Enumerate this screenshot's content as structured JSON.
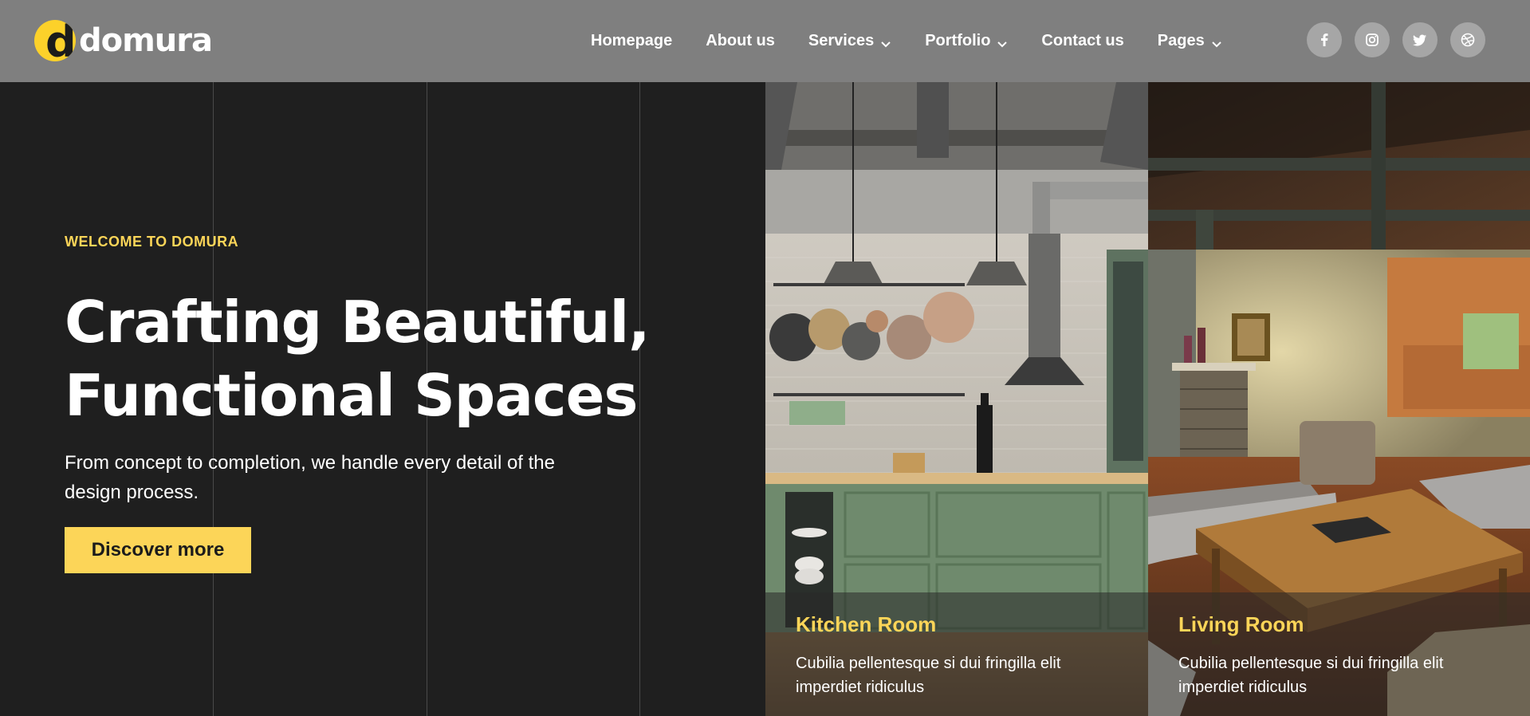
{
  "header": {
    "logo_letter": "d",
    "logo_text": "domura",
    "nav": [
      {
        "label": "Homepage",
        "has_dropdown": false
      },
      {
        "label": "About us",
        "has_dropdown": false
      },
      {
        "label": "Services",
        "has_dropdown": true
      },
      {
        "label": "Portfolio",
        "has_dropdown": true
      },
      {
        "label": "Contact us",
        "has_dropdown": false
      },
      {
        "label": "Pages",
        "has_dropdown": true
      }
    ],
    "socials": [
      "facebook-icon",
      "instagram-icon",
      "twitter-icon",
      "dribbble-icon"
    ]
  },
  "hero": {
    "eyebrow": "WELCOME TO DOMURA",
    "headline_line1": "Crafting Beautiful,",
    "headline_line2": "Functional Spaces",
    "subtext": "From concept to completion, we handle every detail of the design process.",
    "cta_label": "Discover more"
  },
  "cards": [
    {
      "title": "Kitchen Room",
      "text": "Cubilia pellentesque si dui fringilla elit imperdiet ridiculus"
    },
    {
      "title": "Living Room",
      "text": "Cubilia pellentesque si dui fringilla elit imperdiet ridiculus"
    }
  ],
  "colors": {
    "accent": "#fcd558",
    "header_bg": "#7f7f7f",
    "hero_bg": "#1f1f1f"
  }
}
